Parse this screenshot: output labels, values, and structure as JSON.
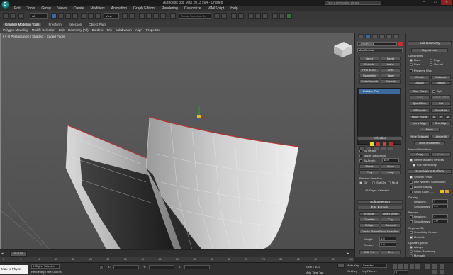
{
  "window": {
    "title": "Autodesk 3ds Max 2013 x64 - Untitled",
    "search_placeholder": "Type a keyword or phrase",
    "logo_letter": "3",
    "min": "–",
    "max": "□",
    "close": "✕"
  },
  "menu": [
    "Edit",
    "Tools",
    "Group",
    "Views",
    "Create",
    "Modifiers",
    "Animation",
    "Graph Editors",
    "Rendering",
    "Customize",
    "MAXScript",
    "Help"
  ],
  "toolbar": {
    "filter_value": "All",
    "view_value": "View",
    "selection_set_placeholder": "Create Selection Se"
  },
  "ribbon": {
    "tabs": [
      "Graphite Modeling Tools",
      "Freeform",
      "Selection",
      "Object Paint"
    ],
    "subtabs": [
      "Polygon Modeling",
      "Modify Selection",
      "Edit",
      "Geometry (All)",
      "Borders",
      "Tris",
      "Subdivision",
      "Align",
      "Properties"
    ]
  },
  "viewport": {
    "label": "[ + ] [ Perspective ] [ Shaded + Edged Faces ]",
    "background": "#5a5a5a",
    "wire_color": "#c03030"
  },
  "command": {
    "object_name": "Cylinder014",
    "modifier_list": "Modifier List",
    "modifier_buttons": [
      "Bend",
      "Bevel",
      "Extrude",
      "Lathe",
      "FFD 3x3x3",
      "Shell",
      "Symmetry",
      "Taper",
      "TurboSmooth",
      "Smooth"
    ],
    "stack_item": "Editable Poly",
    "selection": {
      "header": "Selection",
      "by_vertex": "By Vertex",
      "ignore_backfacing": "Ignore Backfacing",
      "by_angle": "By Angle:",
      "angle_value": "45.0",
      "shrink": "Shrink",
      "grow": "Grow",
      "ring": "Ring",
      "loop": "Loop",
      "preview_selection": "Preview Selection",
      "off": "Off",
      "subobj": "SubObj",
      "multi": "Multi",
      "status": "46 Edges Selected"
    },
    "soft_selection": "Soft Selection",
    "edit_borders": {
      "header": "Edit Borders",
      "extrude": "Extrude",
      "insert_vertex": "Insert Vertex",
      "chamfer": "Chamfer",
      "cap": "Cap",
      "bridge": "Bridge",
      "connect": "Connect",
      "create_shape": "Create Shape From Selection",
      "weight_label": "Weight:",
      "weight_value": "1.0",
      "crease_label": "Crease:",
      "crease_value": "0.0",
      "edit_tri": "Edit Tri.",
      "turn": "Turn"
    }
  },
  "command2": {
    "edit_geometry": "Edit Geometry",
    "repeat_last": "Repeat Last",
    "constraints": "Constraints",
    "none": "None",
    "edge": "Edge",
    "face": "Face",
    "normal": "Normal",
    "preserve_uvs": "Preserve UVs",
    "create": "Create",
    "collapse": "Collapse",
    "attach": "Attach",
    "detach": "Detach",
    "slice_plane": "Slice Plane",
    "split": "Split",
    "slice": "Slice",
    "reset_plane": "Reset Plane",
    "quickslice": "QuickSlice",
    "cut": "Cut",
    "msmooth": "MSmooth",
    "tessellate": "Tessellate",
    "make_planar": "Make Planar",
    "x": "X",
    "y": "Y",
    "z": "Z",
    "view_align": "View Align",
    "grid_align": "Grid Align",
    "relax": "Relax",
    "hide_selected": "Hide Selected",
    "unhide_all": "Unhide All",
    "hide_unselected": "Hide Unselected",
    "named_selections": "Named Selections:",
    "copy": "Copy",
    "paste": "Paste",
    "delete_isolated": "Delete Isolated Vertices",
    "full_interactivity": "Full Interactivity",
    "subdivision_surface": "Subdivision Surface",
    "smooth_result": "Smooth Result",
    "use_nurms": "Use NURMS Subdivision",
    "isoline_display": "Isoline Display",
    "show_cage": "Show Cage.......",
    "display": "Display",
    "iterations": "Iterations:",
    "iterations_value": "1",
    "smoothness": "Smoothness:",
    "smoothness_value": "1.0",
    "render": "Render",
    "separate_by": "Separate By",
    "smoothing_groups": "Smoothing Groups",
    "materials": "Materials",
    "update_options": "Update Options",
    "always": "Always",
    "when_rendering": "When Rendering",
    "manually": "Manually"
  },
  "timeline": {
    "frame": "0 / 100",
    "ticks": [
      "0",
      "5",
      "10",
      "15",
      "20",
      "25",
      "30",
      "35",
      "40",
      "45",
      "50",
      "55",
      "60",
      "65",
      "70",
      "75",
      "80",
      "85",
      "90",
      "95",
      "100"
    ]
  },
  "status": {
    "maxscript": "Max to Physc.",
    "selected": "1 Object Selected",
    "render_time": "Rendering Time: 0:00:00",
    "x_label": "X:",
    "y_label": "Y:",
    "z_label": "Z:",
    "grid": "Grid = 10.0",
    "auto_key": "Auto Key",
    "selected_dropdown": "Selected",
    "set_key": "Set Key",
    "key_filters": "Key Filters...",
    "add_time_tag": "Add Time Tag",
    "frame_value": "0"
  }
}
